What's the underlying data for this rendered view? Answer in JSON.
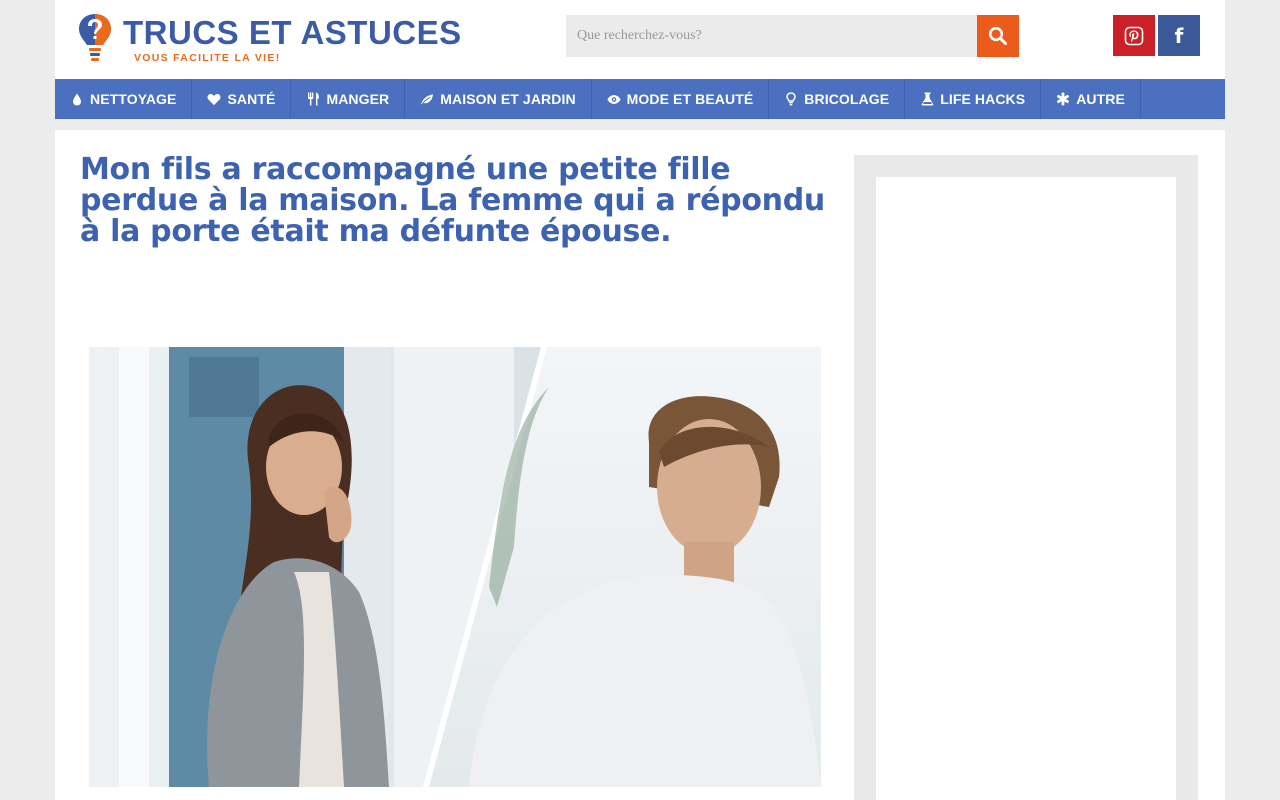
{
  "header": {
    "logo_title": "TRUCS ET ASTUCES",
    "logo_tagline": "VOUS FACILITE LA VIE!",
    "search_placeholder": "Que recherchez-vous?"
  },
  "social": [
    {
      "name": "Pinterest",
      "icon": "pinterest-icon",
      "color": "#cb2027"
    },
    {
      "name": "Facebook",
      "icon": "facebook-icon",
      "color": "#3b5998"
    }
  ],
  "nav": {
    "items": [
      {
        "label": "NETTOYAGE",
        "icon": "drop-icon"
      },
      {
        "label": "SANTÉ",
        "icon": "heart-icon"
      },
      {
        "label": "MANGER",
        "icon": "cutlery-icon"
      },
      {
        "label": "MAISON ET JARDIN",
        "icon": "leaf-icon"
      },
      {
        "label": "MODE ET BEAUTÉ",
        "icon": "eye-icon"
      },
      {
        "label": "BRICOLAGE",
        "icon": "lightbulb-icon"
      },
      {
        "label": "LIFE HACKS",
        "icon": "flask-icon"
      },
      {
        "label": "AUTRE",
        "icon": "asterisk-icon"
      }
    ]
  },
  "article": {
    "title": "Mon fils a raccompagné une petite fille perdue à la maison. La femme qui a répondu à la porte était ma défunte épouse."
  },
  "colors": {
    "brand_blue": "#3b5ba7",
    "nav_blue": "#4a70bf",
    "accent_orange": "#eb5b1c",
    "title_blue": "#3d63b0"
  }
}
